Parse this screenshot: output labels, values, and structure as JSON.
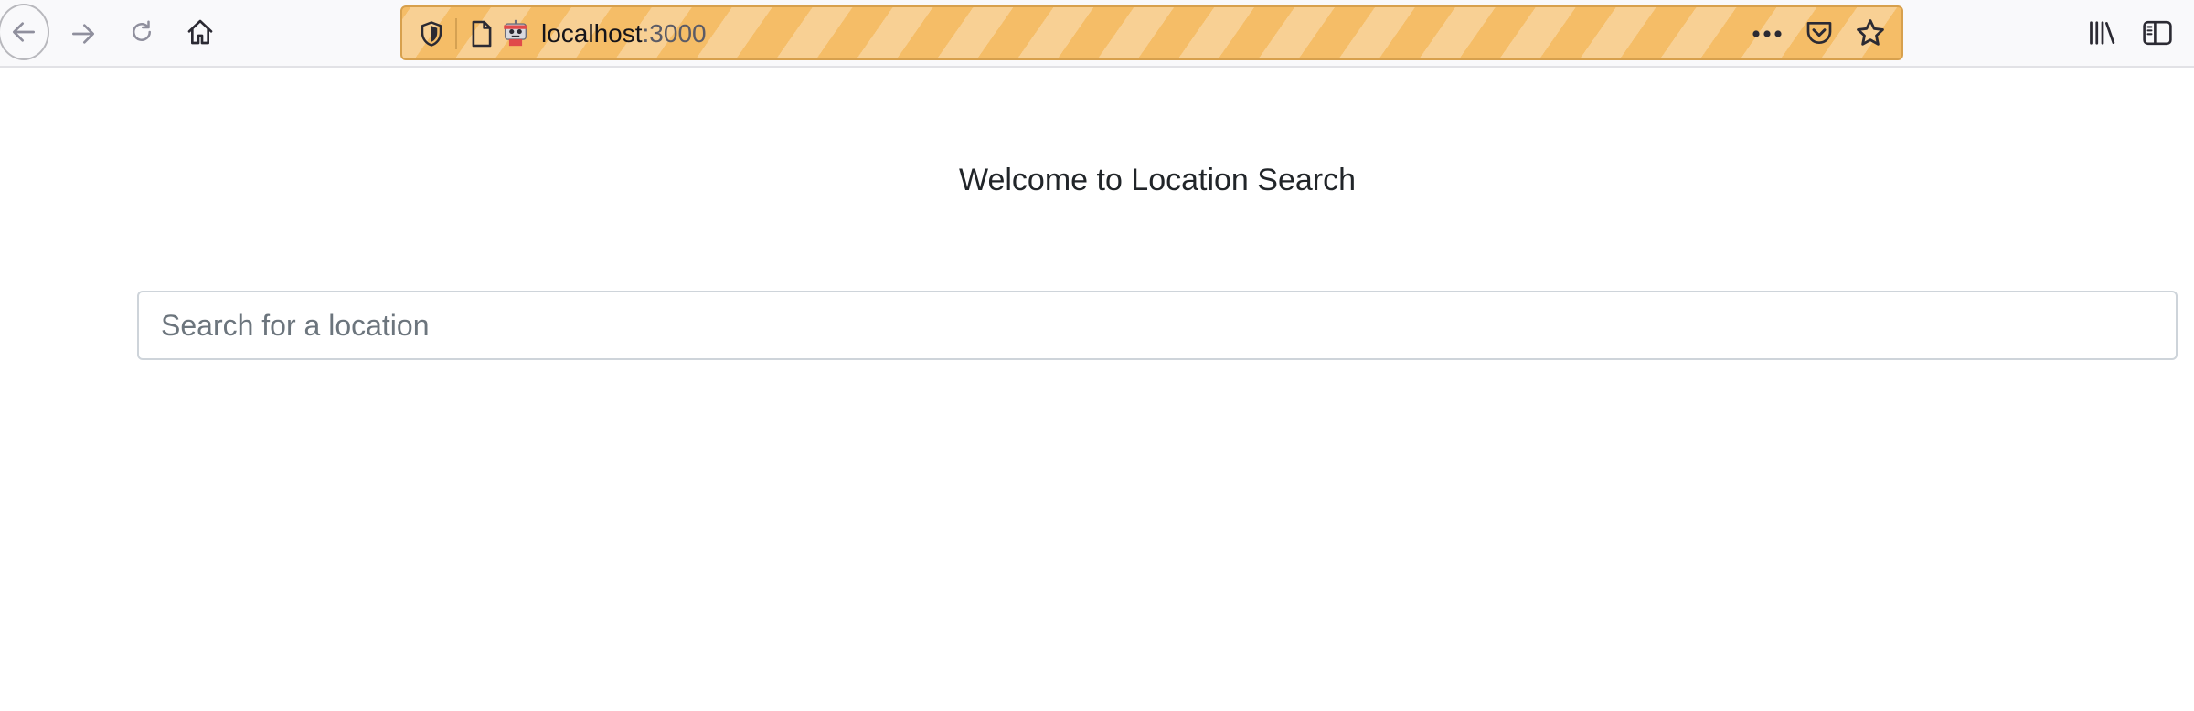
{
  "browser": {
    "url": {
      "host": "localhost",
      "port": ":3000"
    },
    "icons": {
      "back": "back-arrow-icon",
      "forward": "forward-arrow-icon",
      "reload": "reload-icon",
      "home": "home-icon",
      "tracking": "shield-icon",
      "page": "page-icon",
      "remote_control": "robot-icon",
      "page_actions": "more-dots-icon",
      "pocket": "pocket-icon",
      "bookmark": "star-icon",
      "library": "library-icon",
      "sidebar": "sidebar-icon"
    },
    "colors": {
      "urlbar_stripe_dark": "#f5bd67",
      "urlbar_stripe_light": "#f8d094",
      "urlbar_border": "#d7a04d"
    }
  },
  "page": {
    "heading": "Welcome to Location Search",
    "search": {
      "placeholder": "Search for a location",
      "value": ""
    }
  }
}
